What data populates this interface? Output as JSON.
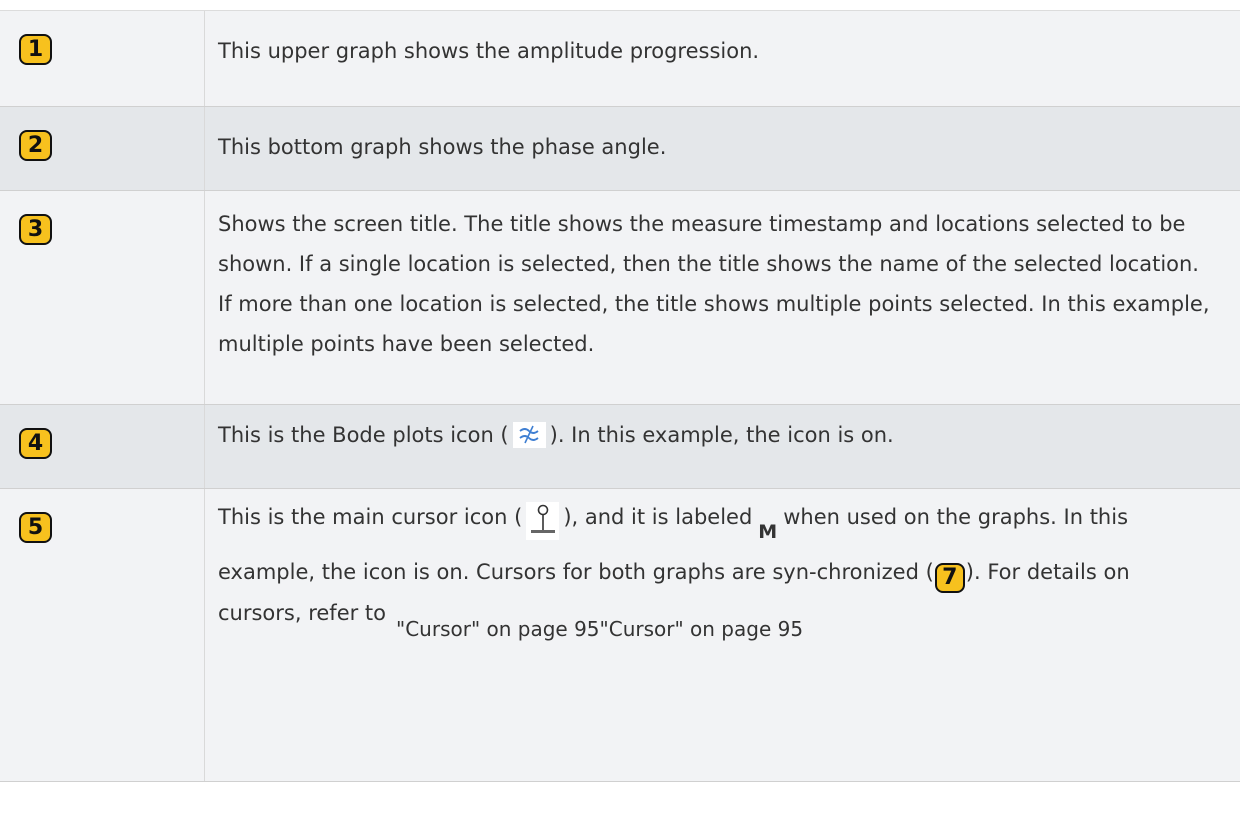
{
  "rows": [
    {
      "number": "1",
      "text": "This upper graph shows the amplitude progression."
    },
    {
      "number": "2",
      "text": "This bottom graph shows the phase angle."
    },
    {
      "number": "3",
      "text": "Shows the screen title. The title shows the measure timestamp and locations selected to be shown. If a single location is selected, then the title shows the name of the selected location. If more than one location is selected, the title shows multiple points selected. In this example, multiple points have been selected."
    },
    {
      "number": "4",
      "text_before": "This is the Bode plots icon (",
      "text_after": "). In this example, the icon is on.",
      "icon": "bode-plots-icon"
    },
    {
      "number": "5",
      "text_a": "This is the main cursor icon (",
      "icon": "main-cursor-icon",
      "text_b": "), and it is labeled",
      "m_label": "M",
      "text_c": "when used on the graphs. In this example, the icon is on. Cursors for both graphs are syn-chronized (",
      "sync_badge": "7",
      "text_d": "). For details on cursors, refer to",
      "xref_text": "\"Cursor\" on page 95\"Cursor\" on page 95"
    }
  ],
  "colors": {
    "badge_fill": "#f7c11e",
    "row_light": "#f2f3f5",
    "row_dark": "#e4e7ea",
    "icon_blue": "#3f7fd2"
  }
}
